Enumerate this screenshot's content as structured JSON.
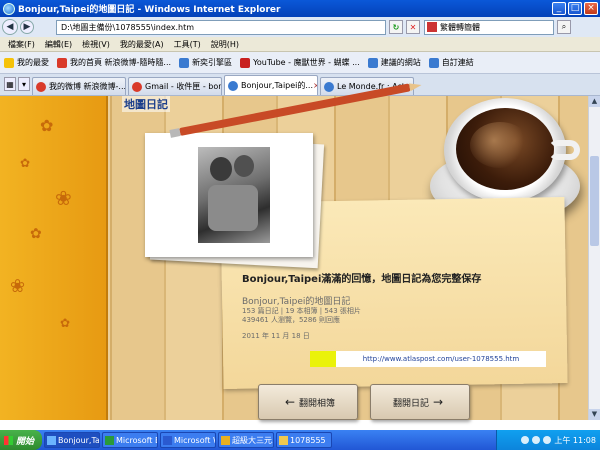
{
  "window": {
    "title": "Bonjour,Taipei的地圖日記 - Windows Internet Explorer"
  },
  "address": {
    "url": "D:\\地圖主備份\\1078555\\index.htm",
    "search_placeholder": "繁體轉簡體"
  },
  "menu": [
    "檔案(F)",
    "編輯(E)",
    "檢視(V)",
    "我的最愛(A)",
    "工具(T)",
    "說明(H)"
  ],
  "favorites": {
    "label": "我的最愛",
    "items": [
      "我的首頁 新浪微博-隨時隨...",
      "新奕引擎區",
      "YouTube - 魔獸世界 - 蝴蝶 ...",
      "建議的網站",
      "自訂連結"
    ]
  },
  "tabs": [
    {
      "label": "我的微博 新浪微博-..."
    },
    {
      "label": "Gmail - 收件匣 - bonj..."
    },
    {
      "label": "Bonjour,Taipei的..."
    },
    {
      "label": "Le Monde.fr : Actuali..."
    }
  ],
  "page": {
    "brand": "地圖日記",
    "headline": "Bonjour,Taipei滿滿的回憶，地圖日記為您完整保存",
    "subtitle": "Bonjour,Taipei的地圖日記",
    "stats_line1": "153 篇日記 | 19 本相簿 | 543 張相片",
    "stats_line2": "439461 人瀏覽，5286 則回應",
    "date": "2011 年 11 月 18 日",
    "url": "http://www.atlaspost.com/user-1078555.htm",
    "btn_album": "翻開相簿",
    "btn_diary": "翻開日記"
  },
  "taskbar": {
    "start": "開始",
    "buttons": [
      "Bonjour,Tai...",
      "Microsoft E...",
      "Microsoft W...",
      "超級大三元...",
      "1078555"
    ],
    "clock": "上午 11:08"
  },
  "colors": {
    "title_blue": "#0a58d8",
    "panel_orange": "#f2b322",
    "highlight_yellow": "#eaf20a",
    "link_blue": "#22439a"
  },
  "icons": [
    "ie-icon",
    "back-icon",
    "forward-icon",
    "refresh-icon",
    "stop-icon",
    "search-icon",
    "star-icon",
    "flower-icon",
    "coffee-cup-icon",
    "pencil-icon",
    "windows-icon"
  ]
}
